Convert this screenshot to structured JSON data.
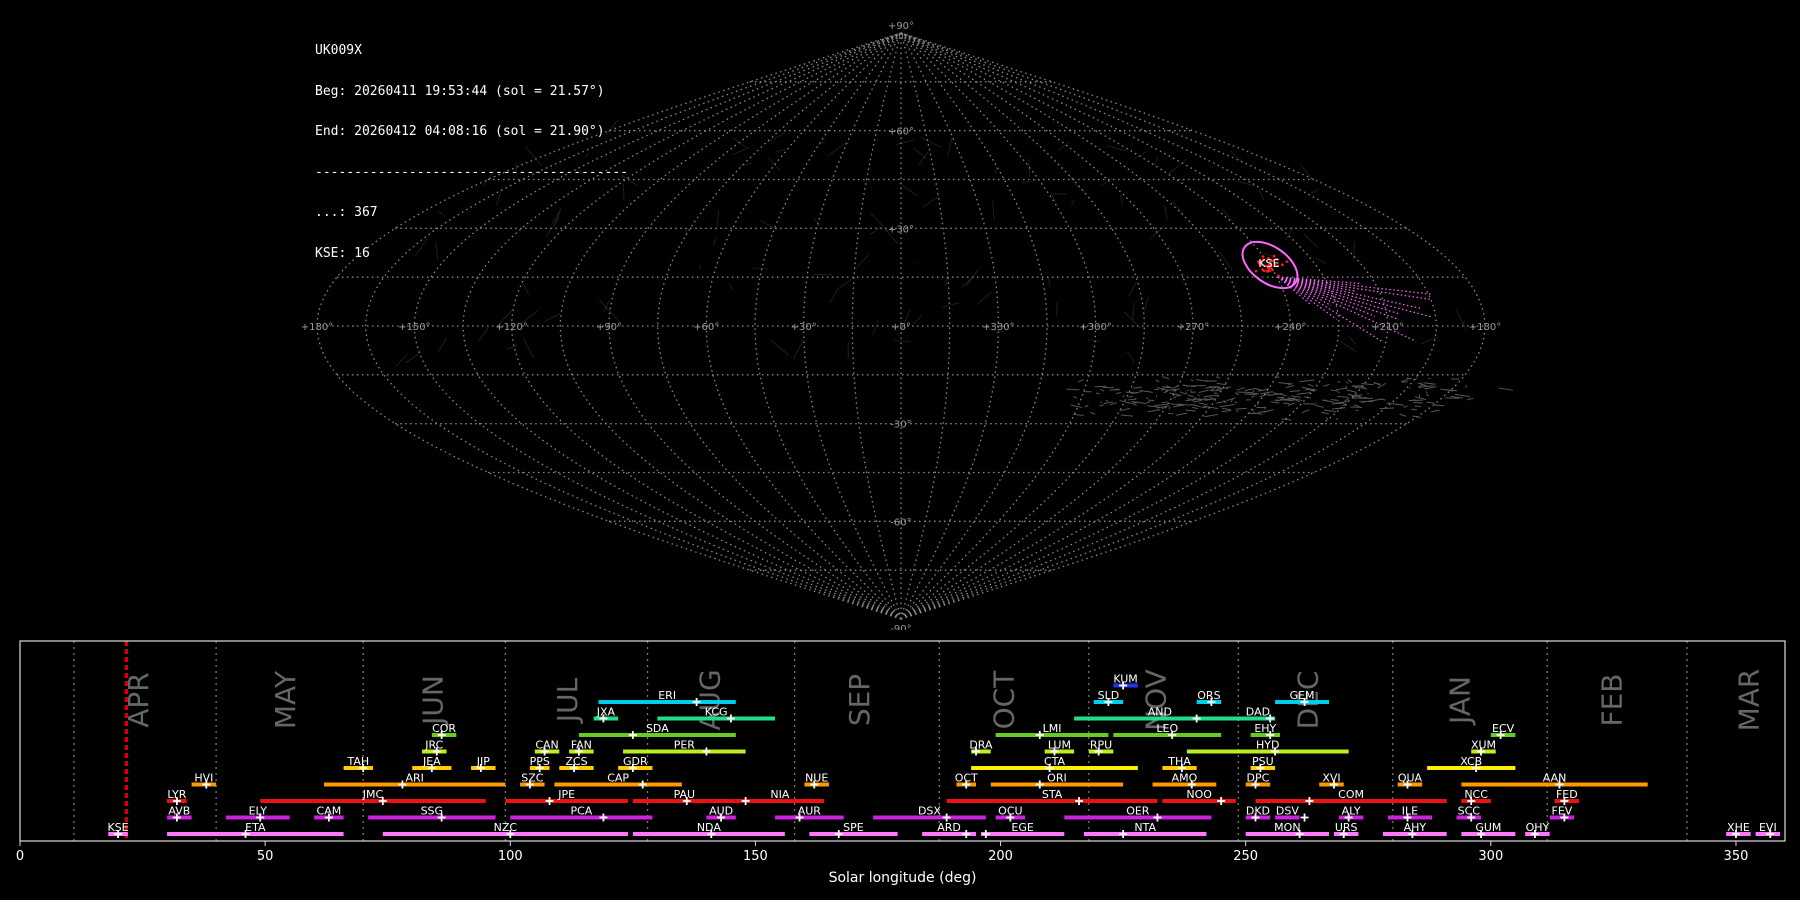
{
  "header": {
    "station": "UK009X",
    "beg": "Beg: 20260411 19:53:44 (sol = 21.57°)",
    "end": "End: 20260412 04:08:16 (sol = 21.90°)",
    "rule": "----------------------------------------",
    "count_other": "...: 367",
    "count_kse": "KSE: 16"
  },
  "sky_map": {
    "projection": "sinusoidal",
    "lon_labels": [
      "+180°",
      "+150°",
      "+120°",
      "+90°",
      "+60°",
      "+30°",
      "+0°",
      "+330°",
      "+300°",
      "+270°",
      "+240°",
      "+210°",
      "+180°"
    ],
    "lat_labels": [
      "+90°",
      "+60°",
      "+30°",
      "-30°",
      "-60°",
      "-90°"
    ],
    "highlight_label": "KSE",
    "highlight_color": "#ff66ff",
    "radiant_color": "#ff2020"
  },
  "chart_data": {
    "type": "bar",
    "title": "",
    "xlabel": "Solar longitude (deg)",
    "ylabel": "",
    "xlim": [
      0,
      360
    ],
    "xticks": [
      0,
      50,
      100,
      150,
      200,
      250,
      300,
      350
    ],
    "current_sol": 21.7,
    "month_labels": [
      {
        "name": "APR",
        "sol": 24.5
      },
      {
        "name": "MAY",
        "sol": 54.5
      },
      {
        "name": "JUN",
        "sol": 84.5
      },
      {
        "name": "JUL",
        "sol": 112
      },
      {
        "name": "AUG",
        "sol": 141
      },
      {
        "name": "SEP",
        "sol": 171.5
      },
      {
        "name": "OCT",
        "sol": 201
      },
      {
        "name": "NOV",
        "sol": 232
      },
      {
        "name": "DEC",
        "sol": 263
      },
      {
        "name": "JAN",
        "sol": 294
      },
      {
        "name": "FEB",
        "sol": 325
      },
      {
        "name": "MAR",
        "sol": 353
      }
    ],
    "month_boundaries": [
      11,
      40,
      70,
      99,
      128,
      158,
      187.5,
      218,
      248.5,
      280,
      311.5,
      340
    ],
    "showers": [
      {
        "code": "KSE",
        "start": 18,
        "end": 22,
        "peak": 20,
        "row": 0,
        "color": "#ff77ff"
      },
      {
        "code": "ETA",
        "start": 30,
        "end": 66,
        "peak": 46,
        "row": 0,
        "color": "#ff77ff"
      },
      {
        "code": "NZC",
        "start": 74,
        "end": 124,
        "peak": 100,
        "row": 0,
        "color": "#ff77ff"
      },
      {
        "code": "NDA",
        "start": 125,
        "end": 156,
        "peak": 141,
        "row": 0,
        "color": "#ff77ff"
      },
      {
        "code": "SPE",
        "start": 161,
        "end": 179,
        "peak": 167,
        "row": 0,
        "color": "#ff77ff"
      },
      {
        "code": "ARD",
        "start": 184,
        "end": 195,
        "peak": 193,
        "row": 0,
        "color": "#ff77ff"
      },
      {
        "code": "EGE",
        "start": 196,
        "end": 213,
        "peak": 197,
        "row": 0,
        "color": "#ff77ff"
      },
      {
        "code": "NTA",
        "start": 217,
        "end": 242,
        "peak": 225,
        "row": 0,
        "color": "#ff77ff"
      },
      {
        "code": "MON",
        "start": 250,
        "end": 267,
        "peak": 261,
        "row": 0,
        "color": "#ff77ff"
      },
      {
        "code": "URS",
        "start": 268,
        "end": 273,
        "peak": 270,
        "row": 0,
        "color": "#ff77ff"
      },
      {
        "code": "AHY",
        "start": 278,
        "end": 291,
        "peak": 284,
        "row": 0,
        "color": "#ff77ff"
      },
      {
        "code": "GUM",
        "start": 294,
        "end": 305,
        "peak": 298,
        "row": 0,
        "color": "#ff77ff"
      },
      {
        "code": "OHY",
        "start": 307,
        "end": 312,
        "peak": 309,
        "row": 0,
        "color": "#ff77ff"
      },
      {
        "code": "XHE",
        "start": 348,
        "end": 353,
        "peak": 350,
        "row": 0,
        "color": "#ff77ff"
      },
      {
        "code": "EVI",
        "start": 354,
        "end": 359,
        "peak": 357,
        "row": 0,
        "color": "#ff77ff"
      },
      {
        "code": "AVB",
        "start": 30,
        "end": 35,
        "peak": 32,
        "row": 1,
        "color": "#cc22dd"
      },
      {
        "code": "ELY",
        "start": 42,
        "end": 55,
        "peak": 49,
        "row": 1,
        "color": "#cc22dd"
      },
      {
        "code": "CAM",
        "start": 60,
        "end": 66,
        "peak": 63,
        "row": 1,
        "color": "#cc22dd"
      },
      {
        "code": "SSG",
        "start": 71,
        "end": 97,
        "peak": 86,
        "row": 1,
        "color": "#cc22dd"
      },
      {
        "code": "PCA",
        "start": 100,
        "end": 129,
        "peak": 119,
        "row": 1,
        "color": "#cc22dd"
      },
      {
        "code": "AUD",
        "start": 140,
        "end": 146,
        "peak": 143,
        "row": 1,
        "color": "#cc22dd"
      },
      {
        "code": "AUR",
        "start": 154,
        "end": 168,
        "peak": 159,
        "row": 1,
        "color": "#cc22dd"
      },
      {
        "code": "DSX",
        "start": 174,
        "end": 197,
        "peak": 189,
        "row": 1,
        "color": "#cc22dd"
      },
      {
        "code": "OCU",
        "start": 199,
        "end": 205,
        "peak": 202,
        "row": 1,
        "color": "#cc22dd"
      },
      {
        "code": "OER",
        "start": 213,
        "end": 243,
        "peak": 232,
        "row": 1,
        "color": "#cc22dd"
      },
      {
        "code": "DKD",
        "start": 250,
        "end": 255,
        "peak": 252,
        "row": 1,
        "color": "#cc22dd"
      },
      {
        "code": "DSV",
        "start": 256,
        "end": 261,
        "peak": 262,
        "row": 1,
        "color": "#cc22dd"
      },
      {
        "code": "ALY",
        "start": 269,
        "end": 274,
        "peak": 271,
        "row": 1,
        "color": "#cc22dd"
      },
      {
        "code": "ILE",
        "start": 279,
        "end": 288,
        "peak": 283,
        "row": 1,
        "color": "#cc22dd"
      },
      {
        "code": "SCC",
        "start": 293,
        "end": 298,
        "peak": 296,
        "row": 1,
        "color": "#cc22dd"
      },
      {
        "code": "FEV",
        "start": 312,
        "end": 317,
        "peak": 315,
        "row": 1,
        "color": "#cc22dd"
      },
      {
        "code": "LYR",
        "start": 30,
        "end": 34,
        "peak": 32,
        "row": 2,
        "color": "#ee1111"
      },
      {
        "code": "JMC",
        "start": 49,
        "end": 95,
        "peak": 74,
        "row": 2,
        "color": "#ee1111"
      },
      {
        "code": "JPE",
        "start": 99,
        "end": 124,
        "peak": 108,
        "row": 2,
        "color": "#ee1111"
      },
      {
        "code": "PAU",
        "start": 125,
        "end": 146,
        "peak": 136,
        "row": 2,
        "color": "#ee1111"
      },
      {
        "code": "NIA",
        "start": 146,
        "end": 164,
        "peak": 148,
        "row": 2,
        "color": "#ee1111"
      },
      {
        "code": "STA",
        "start": 189,
        "end": 232,
        "peak": 216,
        "row": 2,
        "color": "#ee1111"
      },
      {
        "code": "NOO",
        "start": 233,
        "end": 248,
        "peak": 245,
        "row": 2,
        "color": "#ee1111"
      },
      {
        "code": "COM",
        "start": 252,
        "end": 291,
        "peak": 263,
        "row": 2,
        "color": "#ee1111"
      },
      {
        "code": "NCC",
        "start": 294,
        "end": 300,
        "peak": 296,
        "row": 2,
        "color": "#ee1111"
      },
      {
        "code": "FED",
        "start": 313,
        "end": 318,
        "peak": 315,
        "row": 2,
        "color": "#ee1111"
      },
      {
        "code": "HVI",
        "start": 35,
        "end": 40,
        "peak": 38,
        "row": 3,
        "color": "#ff9900"
      },
      {
        "code": "ARI",
        "start": 62,
        "end": 99,
        "peak": 78,
        "row": 3,
        "color": "#ff9900"
      },
      {
        "code": "SZC",
        "start": 102,
        "end": 107,
        "peak": 104,
        "row": 3,
        "color": "#ff9900"
      },
      {
        "code": "CAP",
        "start": 109,
        "end": 135,
        "peak": 127,
        "row": 3,
        "color": "#ff9900"
      },
      {
        "code": "NUE",
        "start": 160,
        "end": 165,
        "peak": 162,
        "row": 3,
        "color": "#ff9900"
      },
      {
        "code": "OCT",
        "start": 191,
        "end": 195,
        "peak": 193,
        "row": 3,
        "color": "#ff9900"
      },
      {
        "code": "ORI",
        "start": 198,
        "end": 225,
        "peak": 208,
        "row": 3,
        "color": "#ff9900"
      },
      {
        "code": "AMO",
        "start": 231,
        "end": 244,
        "peak": 239,
        "row": 3,
        "color": "#ff9900"
      },
      {
        "code": "DPC",
        "start": 250,
        "end": 255,
        "peak": 252,
        "row": 3,
        "color": "#ff9900"
      },
      {
        "code": "XVI",
        "start": 265,
        "end": 270,
        "peak": 268,
        "row": 3,
        "color": "#ff9900"
      },
      {
        "code": "QUA",
        "start": 281,
        "end": 286,
        "peak": 283,
        "row": 3,
        "color": "#ff9900"
      },
      {
        "code": "AAN",
        "start": 294,
        "end": 332,
        "peak": 314,
        "row": 3,
        "color": "#ff9900"
      },
      {
        "code": "TAH",
        "start": 66,
        "end": 72,
        "peak": 70,
        "row": 4,
        "color": "#ffcc00"
      },
      {
        "code": "JEA",
        "start": 80,
        "end": 88,
        "peak": 84,
        "row": 4,
        "color": "#ffcc00"
      },
      {
        "code": "JIP",
        "start": 92,
        "end": 97,
        "peak": 94,
        "row": 4,
        "color": "#ffcc00"
      },
      {
        "code": "PPS",
        "start": 104,
        "end": 108,
        "peak": 106,
        "row": 4,
        "color": "#ffcc00"
      },
      {
        "code": "ZCS",
        "start": 110,
        "end": 117,
        "peak": 113,
        "row": 4,
        "color": "#ffcc00"
      },
      {
        "code": "GDR",
        "start": 122,
        "end": 129,
        "peak": 125,
        "row": 4,
        "color": "#ffcc00"
      },
      {
        "code": "CTA",
        "start": 194,
        "end": 228,
        "peak": 210,
        "row": 4,
        "color": "#ffee00"
      },
      {
        "code": "THA",
        "start": 233,
        "end": 240,
        "peak": 237,
        "row": 4,
        "color": "#ffcc00"
      },
      {
        "code": "PSU",
        "start": 251,
        "end": 256,
        "peak": 253,
        "row": 4,
        "color": "#ffcc00"
      },
      {
        "code": "XCB",
        "start": 287,
        "end": 305,
        "peak": 297,
        "row": 4,
        "color": "#ffee00"
      },
      {
        "code": "JRC",
        "start": 82,
        "end": 87,
        "peak": 85,
        "row": 5,
        "color": "#bbee22"
      },
      {
        "code": "CAN",
        "start": 105,
        "end": 110,
        "peak": 107,
        "row": 5,
        "color": "#bbee22"
      },
      {
        "code": "FAN",
        "start": 112,
        "end": 117,
        "peak": 114,
        "row": 5,
        "color": "#bbee22"
      },
      {
        "code": "PER",
        "start": 123,
        "end": 148,
        "peak": 140,
        "row": 5,
        "color": "#bbee22"
      },
      {
        "code": "DRA",
        "start": 194,
        "end": 198,
        "peak": 195,
        "row": 5,
        "color": "#bbee22"
      },
      {
        "code": "LUM",
        "start": 209,
        "end": 215,
        "peak": 211,
        "row": 5,
        "color": "#bbee22"
      },
      {
        "code": "RPU",
        "start": 218,
        "end": 223,
        "peak": 220,
        "row": 5,
        "color": "#bbee22"
      },
      {
        "code": "HYD",
        "start": 238,
        "end": 271,
        "peak": 256,
        "row": 5,
        "color": "#bbee22"
      },
      {
        "code": "XUM",
        "start": 296,
        "end": 301,
        "peak": 298,
        "row": 5,
        "color": "#bbee22"
      },
      {
        "code": "COR",
        "start": 84,
        "end": 89,
        "peak": 86,
        "row": 6,
        "color": "#66cc22"
      },
      {
        "code": "SDA",
        "start": 114,
        "end": 146,
        "peak": 125,
        "row": 6,
        "color": "#66cc22"
      },
      {
        "code": "LMI",
        "start": 199,
        "end": 222,
        "peak": 208,
        "row": 6,
        "color": "#66cc22"
      },
      {
        "code": "LEO",
        "start": 223,
        "end": 245,
        "peak": 235,
        "row": 6,
        "color": "#66cc22"
      },
      {
        "code": "EHY",
        "start": 251,
        "end": 257,
        "peak": 255,
        "row": 6,
        "color": "#66cc22"
      },
      {
        "code": "ECV",
        "start": 300,
        "end": 305,
        "peak": 302,
        "row": 6,
        "color": "#66cc22"
      },
      {
        "code": "JXA",
        "start": 117,
        "end": 122,
        "peak": 119,
        "row": 7,
        "color": "#22dd88"
      },
      {
        "code": "KCG",
        "start": 130,
        "end": 154,
        "peak": 145,
        "row": 7,
        "color": "#22dd88"
      },
      {
        "code": "AND",
        "start": 215,
        "end": 250,
        "peak": 240,
        "row": 7,
        "color": "#22dd88"
      },
      {
        "code": "DAD",
        "start": 249,
        "end": 256,
        "peak": 255,
        "row": 7,
        "color": "#22dd88"
      },
      {
        "code": "ERI",
        "start": 118,
        "end": 146,
        "peak": 138,
        "row": 8,
        "color": "#00ccee"
      },
      {
        "code": "SLD",
        "start": 219,
        "end": 225,
        "peak": 222,
        "row": 8,
        "color": "#00ccee"
      },
      {
        "code": "ORS",
        "start": 240,
        "end": 245,
        "peak": 243,
        "row": 8,
        "color": "#00ccee"
      },
      {
        "code": "GEM",
        "start": 256,
        "end": 267,
        "peak": 262,
        "row": 8,
        "color": "#00ccee"
      },
      {
        "code": "KUM",
        "start": 223,
        "end": 228,
        "peak": 225,
        "row": 9,
        "color": "#2233ee"
      }
    ]
  }
}
